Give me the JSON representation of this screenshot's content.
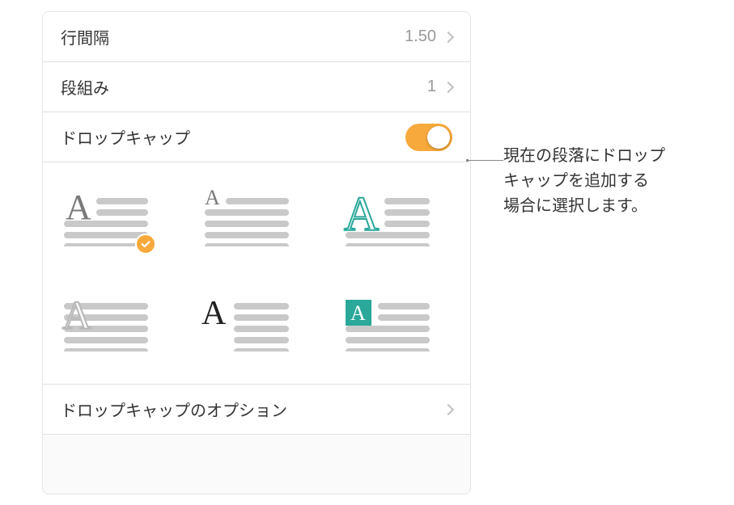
{
  "rows": {
    "lineSpacing": {
      "label": "行間隔",
      "value": "1.50"
    },
    "columns": {
      "label": "段組み",
      "value": "1"
    },
    "dropCap": {
      "label": "ドロップキャップ"
    },
    "options": {
      "label": "ドロップキャップのオプション"
    }
  },
  "styles": {
    "selectedIndex": 0,
    "items": [
      {
        "name": "raised-gray"
      },
      {
        "name": "raised-small"
      },
      {
        "name": "outline-teal"
      },
      {
        "name": "outline-gray"
      },
      {
        "name": "sidebar-black"
      },
      {
        "name": "boxed-teal"
      }
    ]
  },
  "callout": {
    "line1": "現在の段落にドロップ",
    "line2": "キャップを追加する",
    "line3": "場合に選択します。"
  },
  "colors": {
    "accent": "#f7a93b",
    "teal": "#2aa89a",
    "lineGray": "#c9c9c9"
  }
}
